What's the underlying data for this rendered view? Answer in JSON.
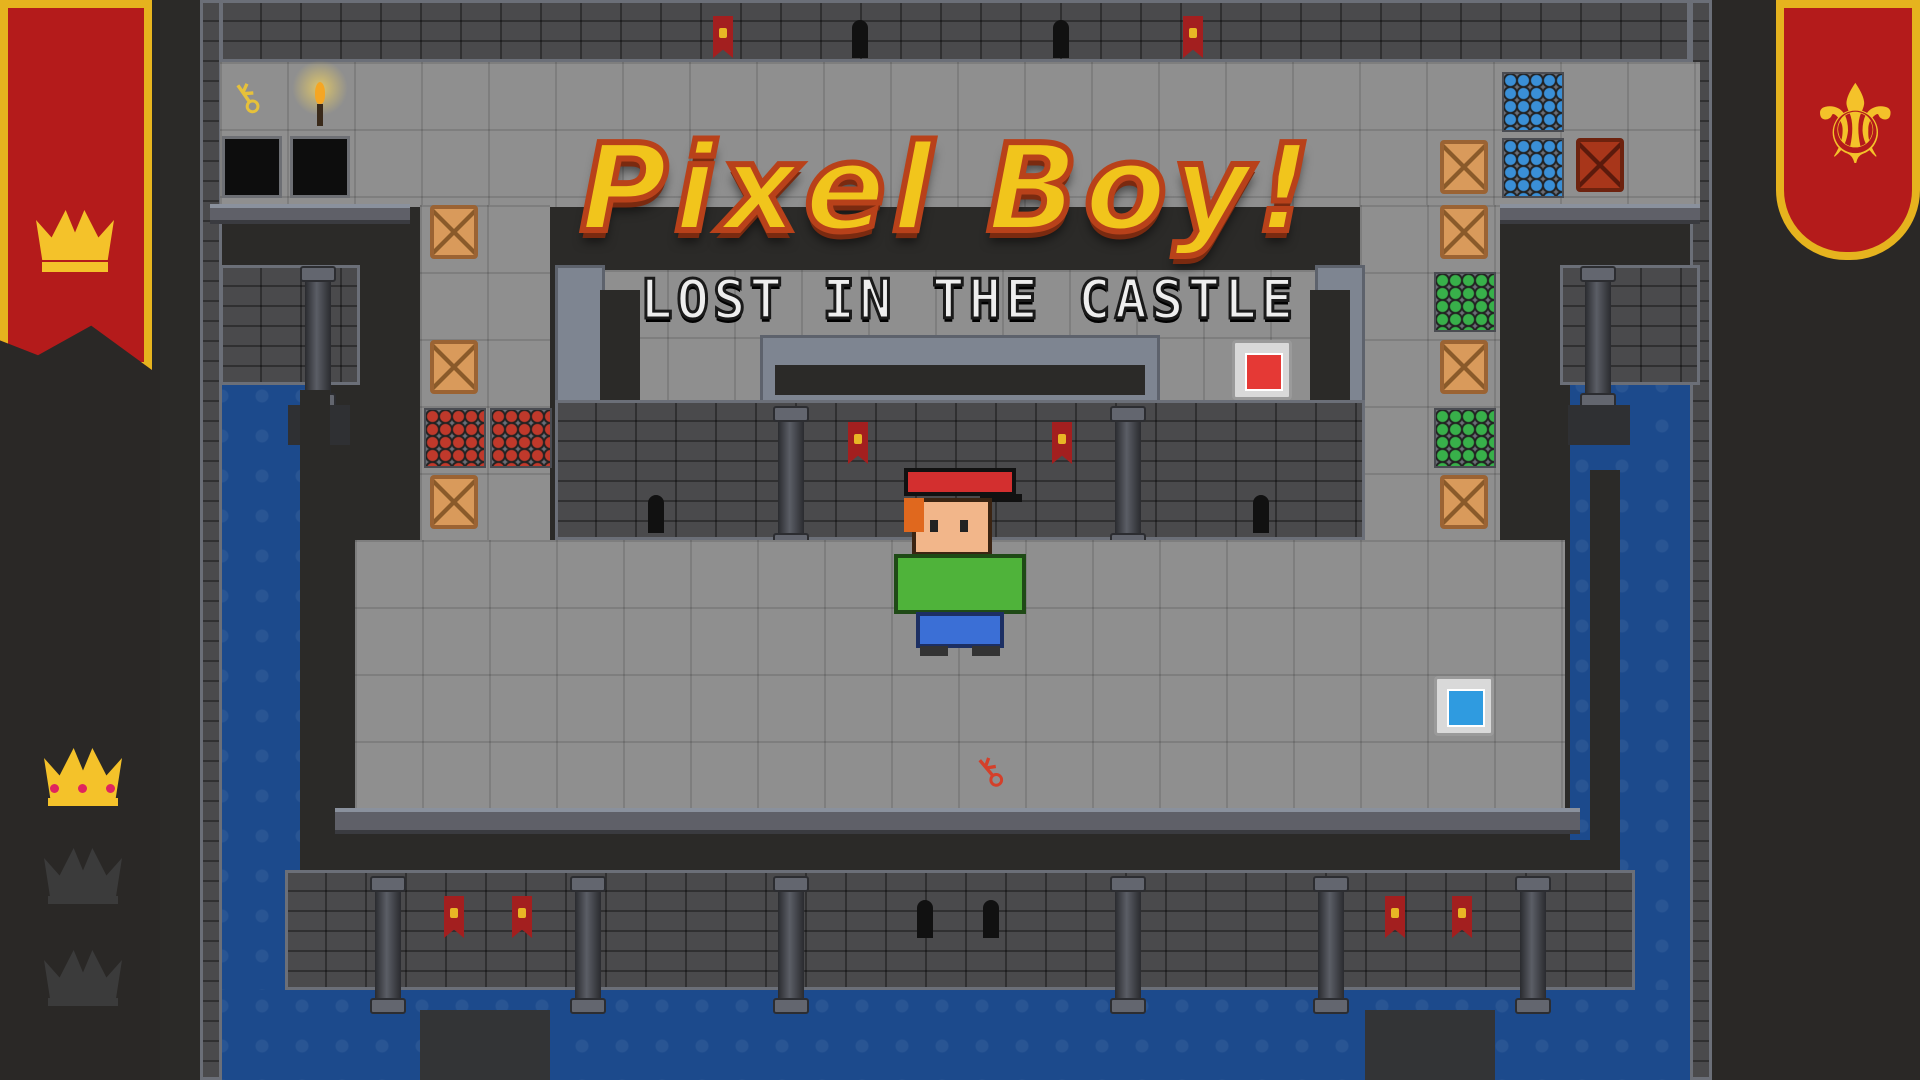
{
  "game": {
    "title": "Pixel Boy!",
    "subtitle": "LOST IN THE CASTLE"
  },
  "hud": {
    "crowns_total": 3,
    "crowns_collected": 1,
    "keys": [
      "gold-key",
      "red-key"
    ]
  },
  "icons": {
    "left_banner": "crown-icon",
    "right_banner": "fleur-de-lis-icon",
    "gold_key": "key-icon",
    "red_key": "key-icon",
    "torch": "torch-icon"
  },
  "colors": {
    "moat": "#1c4a8c",
    "floor": "#8f8f8f",
    "banner_red": "#b41b1b",
    "banner_gold": "#e6b31e",
    "title_yellow": "#f1c51c",
    "pad_red": "#e53935",
    "pad_blue": "#2f9be0"
  }
}
